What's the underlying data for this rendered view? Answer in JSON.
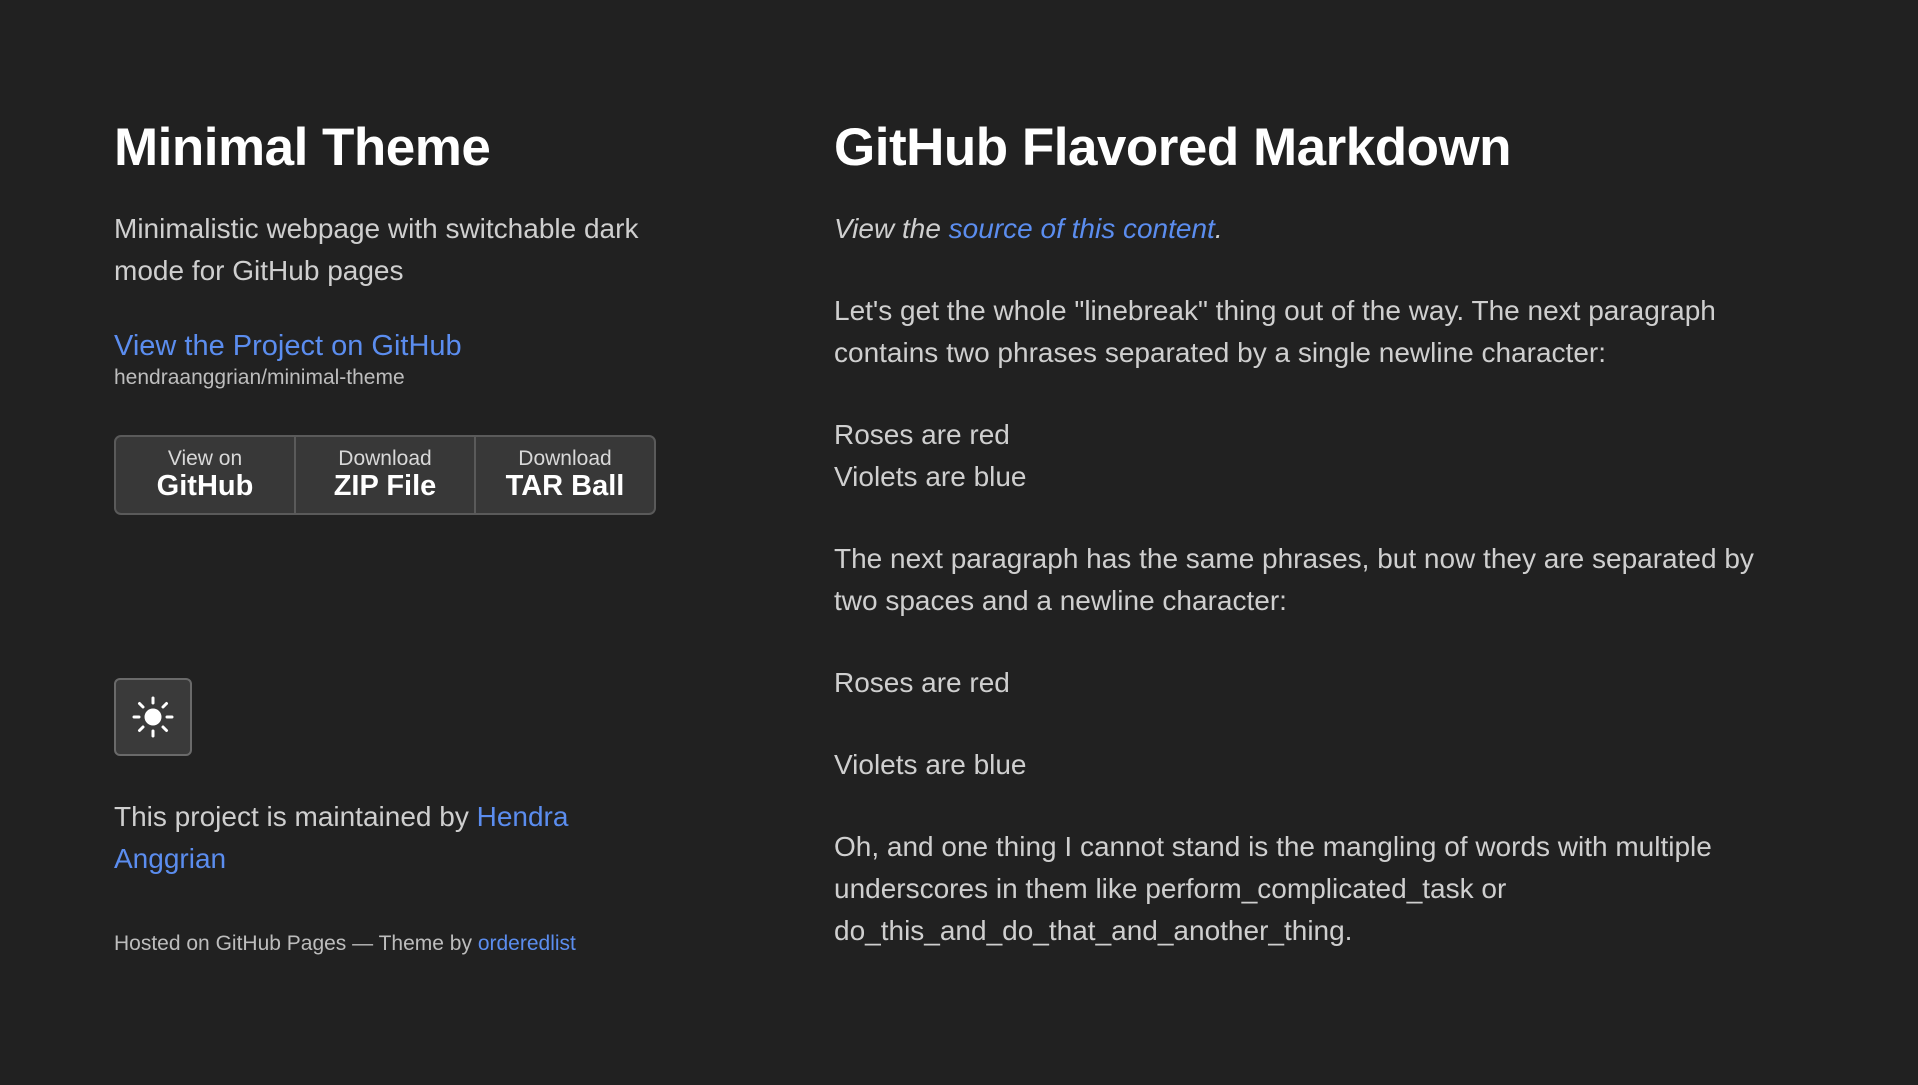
{
  "sidebar": {
    "title": "Minimal Theme",
    "tagline": "Minimalistic webpage with switchable dark mode for GitHub pages",
    "project_link": "View the Project on GitHub",
    "repo_path": "hendraanggrian/minimal-theme",
    "downloads": [
      {
        "small": "View on",
        "big": "GitHub"
      },
      {
        "small": "Download",
        "big": "ZIP File"
      },
      {
        "small": "Download",
        "big": "TAR Ball"
      }
    ],
    "theme_toggle_icon": "sun-icon",
    "maintained_prefix": "This project is maintained by ",
    "maintainer": "Hendra Anggrian",
    "hosted_prefix": "Hosted on GitHub Pages — Theme by ",
    "theme_author": "orderedlist"
  },
  "main": {
    "title": "GitHub Flavored Markdown",
    "source_prefix": "View the ",
    "source_link": "source of this content",
    "source_suffix": ".",
    "para1": "Let's get the whole \"linebreak\" thing out of the way. The next paragraph contains two phrases separated by a single newline character:",
    "roses1": "Roses are red",
    "violets1": "Violets are blue",
    "para2": "The next paragraph has the same phrases, but now they are separated by two spaces and a newline character:",
    "roses2": "Roses are red",
    "violets2": "Violets are blue",
    "para3": "Oh, and one thing I cannot stand is the mangling of words with multiple underscores in them like perform_complicated_task or do_this_and_do_that_and_another_thing."
  },
  "colors": {
    "background": "#212121",
    "link": "#5b8def",
    "heading": "#ffffff",
    "text": "#cfcfcf"
  }
}
